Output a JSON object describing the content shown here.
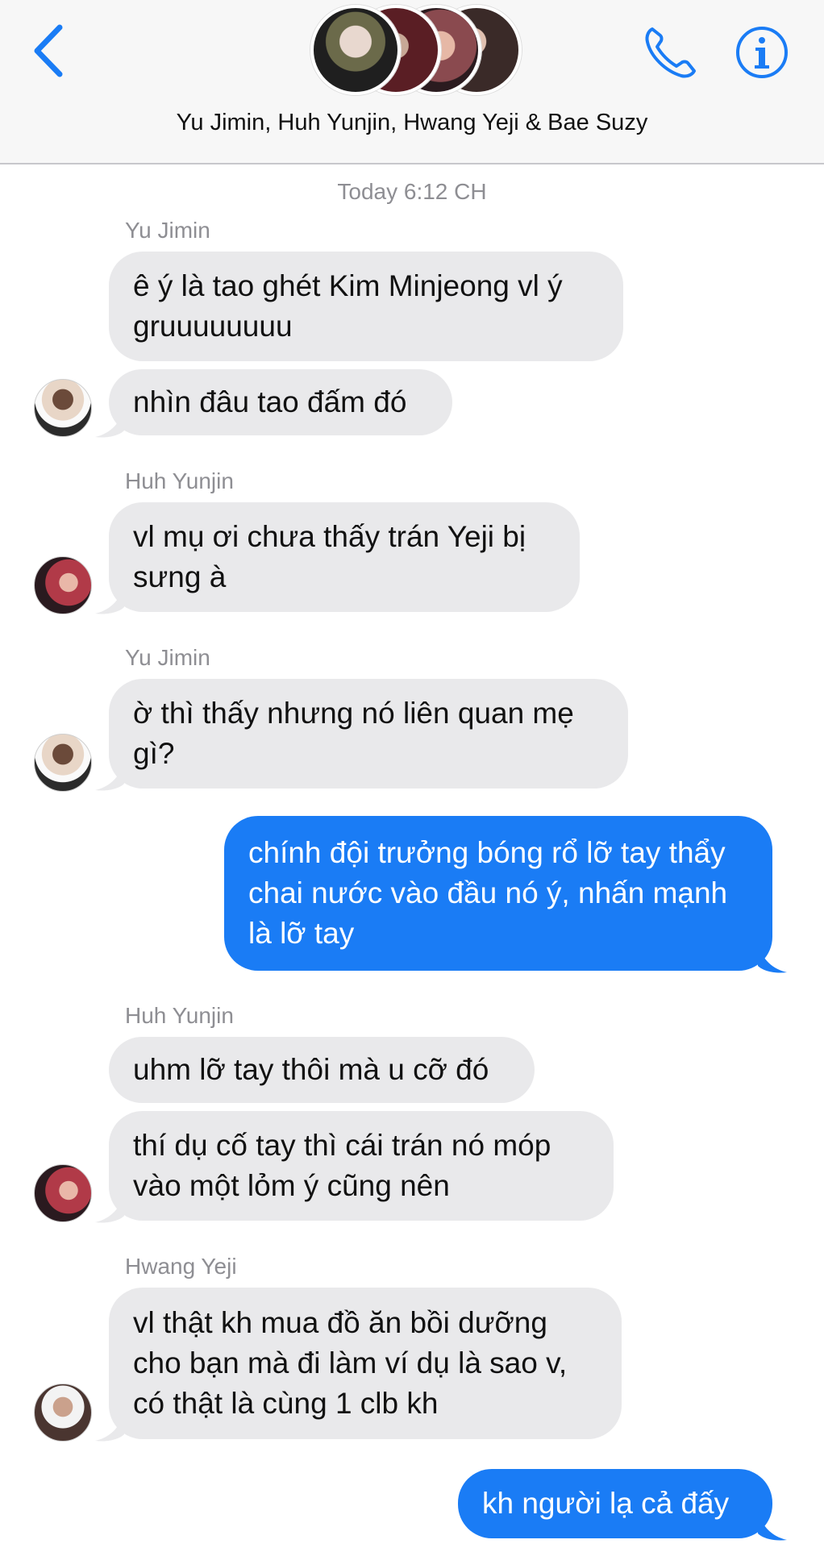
{
  "header": {
    "title": "Yu Jimin, Huh Yunjin, Hwang Yeji & Bae Suzy",
    "colors": {
      "accent": "#1a7cf5",
      "header_bg": "#f7f7f7"
    }
  },
  "thread": {
    "timestamp": "Today 6:12 CH",
    "messages": [
      {
        "sender": "Yu Jimin",
        "text": "ê ý là tao ghét Kim Minjeong vl ý gruuuuuuuu"
      },
      {
        "text": "nhìn đâu tao đấm đó"
      },
      {
        "sender": "Huh Yunjin",
        "text": "vl mụ ơi chưa thấy trán Yeji bị sưng à"
      },
      {
        "sender": "Yu Jimin",
        "text": "ờ thì thấy nhưng nó liên quan mẹ gì?"
      },
      {
        "text": "chính đội trưởng bóng rổ lỡ tay thẩy chai nước vào đầu nó ý, nhấn mạnh là lỡ tay"
      },
      {
        "sender": "Huh Yunjin",
        "text": "uhm lỡ tay thôi mà u cỡ đó"
      },
      {
        "text": "thí dụ cố tay thì cái trán nó móp vào một lỏm ý cũng nên"
      },
      {
        "sender": "Hwang Yeji",
        "text": "vl thật kh mua đồ ăn bồi dưỡng cho bạn mà đi làm ví dụ là sao v, có thật là cùng 1 clb kh"
      },
      {
        "text": "kh người lạ cả đấy"
      }
    ]
  },
  "icons": [
    "back-chevron-icon",
    "phone-icon",
    "info-icon"
  ]
}
